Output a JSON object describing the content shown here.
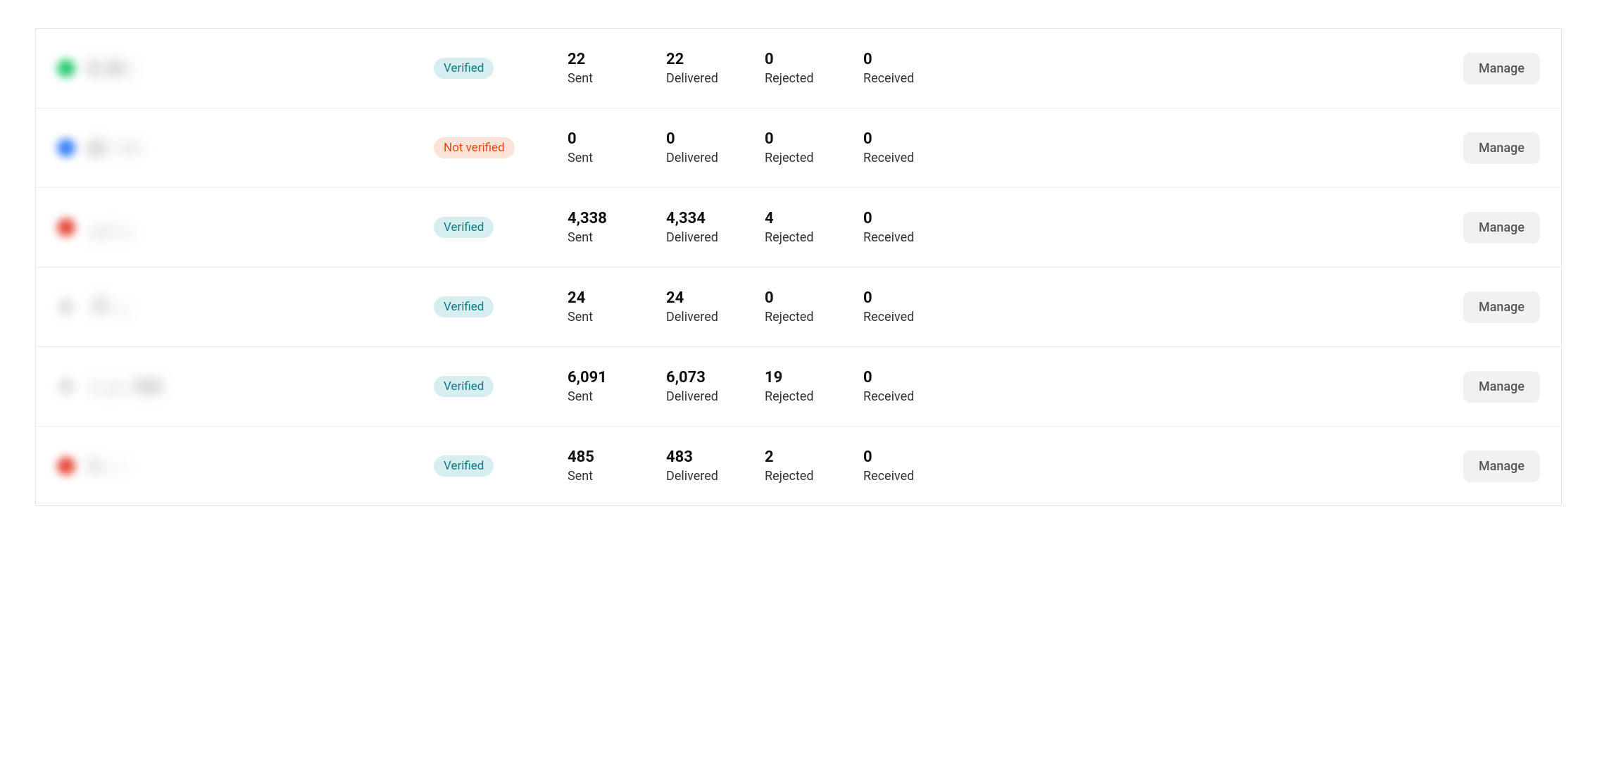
{
  "labels": {
    "sent": "Sent",
    "delivered": "Delivered",
    "rejected": "Rejected",
    "received": "Received",
    "manage": "Manage",
    "verified": "Verified",
    "not_verified": "Not verified"
  },
  "rows": [
    {
      "status": "verified",
      "sent": "22",
      "delivered": "22",
      "rejected": "0",
      "received": "0",
      "dot": "green",
      "blur": "h.   A~."
    },
    {
      "status": "not_verified",
      "sent": "0",
      "delivered": "0",
      "rejected": "0",
      "received": "0",
      "dot": "blue",
      "blur": "aI - ~~"
    },
    {
      "status": "verified",
      "sent": "4,338",
      "delivered": "4,334",
      "rejected": "4",
      "received": "0",
      "dot": "red",
      "blur": "___- _"
    },
    {
      "status": "verified",
      "sent": "24",
      "delivered": "24",
      "rejected": "0",
      "received": "0",
      "dot": "faint",
      "blur": "-T-   ..."
    },
    {
      "status": "verified",
      "sent": "6,091",
      "delivered": "6,073",
      "rejected": "19",
      "received": "0",
      "dot": "faint",
      "blur": "~ _~ .  h.h"
    },
    {
      "status": "verified",
      "sent": "485",
      "delivered": "483",
      "rejected": "2",
      "received": "0",
      "dot": "red",
      "blur": "i~  .   -"
    }
  ]
}
